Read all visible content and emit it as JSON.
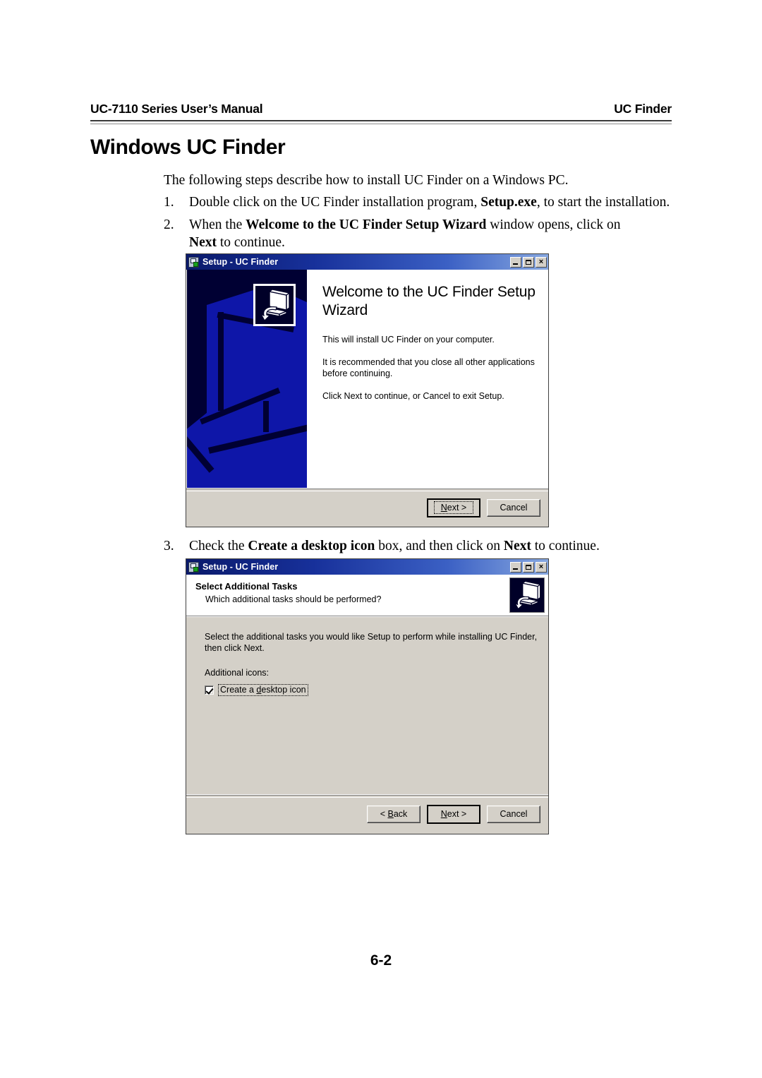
{
  "header": {
    "left": "UC-7110 Series User’s Manual",
    "right": "UC Finder"
  },
  "chapter_title": "Windows UC Finder",
  "intro": "The following steps describe how to install UC Finder on a Windows PC.",
  "steps": [
    {
      "number": "1.",
      "parts": [
        {
          "text": "Double click on the UC Finder installation program, ",
          "bold": false
        },
        {
          "text": "Setup.exe",
          "bold": true
        },
        {
          "text": ", to start the installation.",
          "bold": false
        }
      ]
    },
    {
      "number": "2.",
      "parts": [
        {
          "text": "When the ",
          "bold": false
        },
        {
          "text": "Welcome to the UC Finder Setup Wizard",
          "bold": true
        },
        {
          "text": " window opens, click on ",
          "bold": false
        },
        {
          "text": "Next",
          "bold": true
        },
        {
          "text": " to continue.",
          "bold": false
        }
      ]
    },
    {
      "number": "3.",
      "parts": [
        {
          "text": "Check the ",
          "bold": false
        },
        {
          "text": "Create a desktop icon",
          "bold": true
        },
        {
          "text": " box, and then click on ",
          "bold": false
        },
        {
          "text": "Next",
          "bold": true
        },
        {
          "text": " to continue.",
          "bold": false
        }
      ]
    }
  ],
  "page_number": "6-2",
  "dialog_welcome": {
    "title": "Setup - UC Finder",
    "window_buttons": {
      "minimize": "minimize-icon",
      "maximize": "maximize-icon",
      "close": "×"
    },
    "heading": "Welcome to the UC Finder Setup Wizard",
    "paragraphs": [
      "This will install UC Finder on your computer.",
      "It is recommended that you close all other applications before continuing.",
      "Click Next to continue, or Cancel to exit Setup."
    ],
    "buttons": {
      "next_prefix": "N",
      "next_suffix": "ext >",
      "cancel": "Cancel"
    }
  },
  "dialog_tasks": {
    "title": "Setup - UC Finder",
    "window_buttons": {
      "minimize": "minimize-icon",
      "maximize": "maximize-icon",
      "close": "×"
    },
    "head_title": "Select Additional Tasks",
    "head_subtitle": "Which additional tasks should be performed?",
    "instruction": "Select the additional tasks you would like Setup to perform while installing UC Finder, then click Next.",
    "group_label": "Additional icons:",
    "checkbox": {
      "checked": true,
      "label_prefix": "Create a ",
      "label_accel": "d",
      "label_suffix": "esktop icon"
    },
    "buttons": {
      "back_prefix": "< ",
      "back_accel": "B",
      "back_suffix": "ack",
      "next_prefix": "N",
      "next_suffix": "ext >",
      "cancel": "Cancel"
    }
  },
  "colors": {
    "titlebar_dark": "#0a1a6b",
    "titlebar_light": "#86a7e0",
    "dialog_face": "#d4d0c8",
    "banner_bg": "#000033",
    "banner_blue": "#0e16a8"
  }
}
